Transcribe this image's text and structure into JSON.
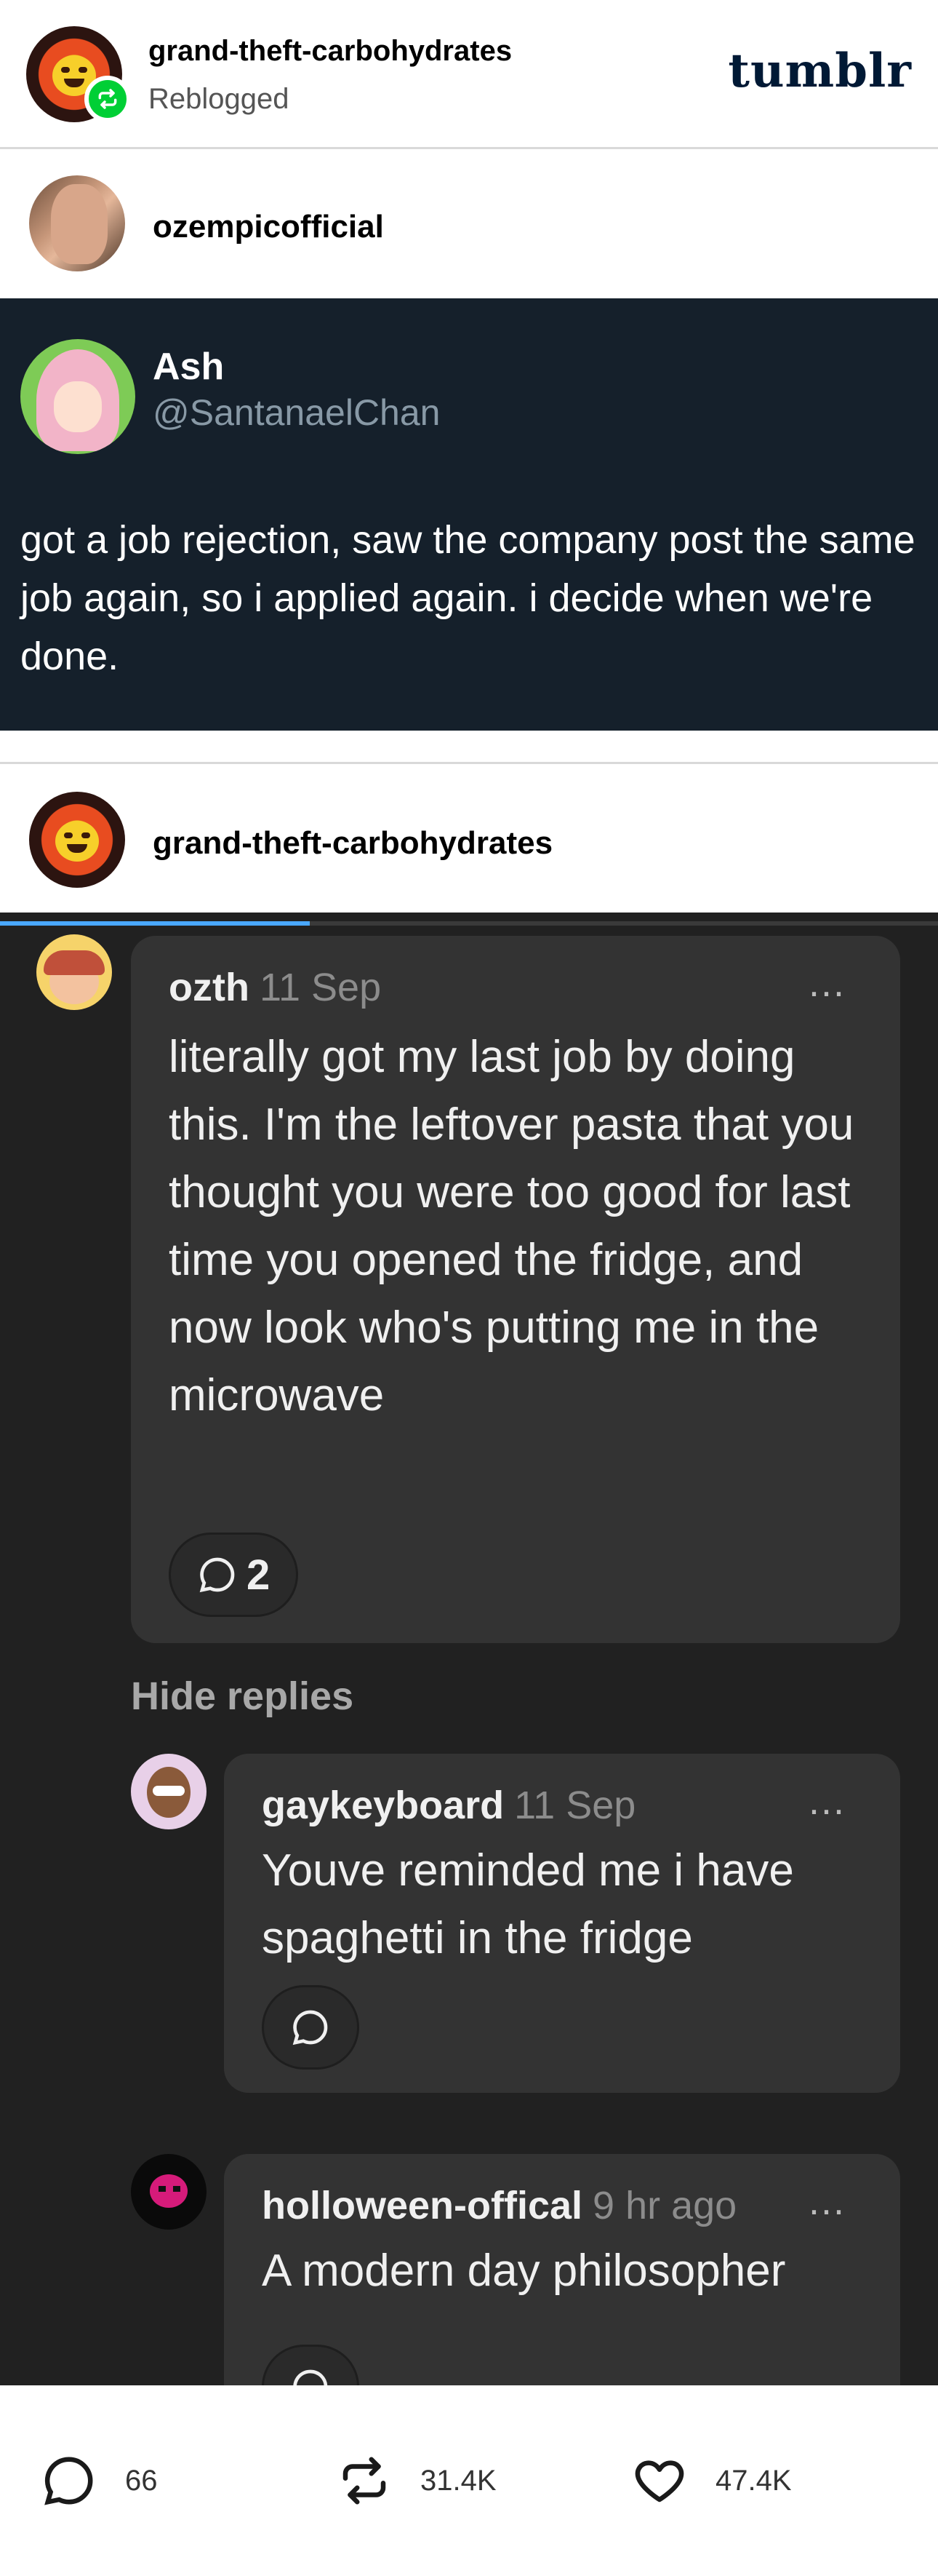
{
  "post_header": {
    "username": "grand-theft-carbohydrates",
    "status": "Reblogged",
    "logo": "tumblr"
  },
  "trail": [
    {
      "username": "ozempicofficial"
    },
    {
      "username": "grand-theft-carbohydrates"
    }
  ],
  "tweet": {
    "display_name": "Ash",
    "handle": "@SantanaelChan",
    "text": "got a job rejection, saw the company post the same job again, so i applied again. i decide when we're done."
  },
  "replies_screenshot": {
    "scroll_progress_fraction": 0.33,
    "comment": {
      "author": "ozth",
      "date": "11 Sep",
      "text": "literally got my last job by doing this. I'm the leftover pasta that you thought you were too good for last time you opened the fridge, and now look who's putting me in the microwave",
      "reply_count": "2"
    },
    "hide_replies_label": "Hide replies",
    "replies": [
      {
        "author": "gaykeyboard",
        "date": "11 Sep",
        "text": "Youve reminded me i have spaghetti in the fridge"
      },
      {
        "author": "holloween-offical",
        "date": "9 hr ago",
        "text": "A modern day philosopher"
      }
    ],
    "more_icon": "..."
  },
  "footer": {
    "comments": "66",
    "reblogs": "31.4K",
    "likes": "47.4K"
  },
  "colors": {
    "tweet_bg": "#15202b",
    "replies_bg": "#212121",
    "bubble_bg": "#333333",
    "reblog_green": "#00cf35",
    "progress_blue": "#4aa8ff",
    "tumblr_navy": "#001935"
  }
}
